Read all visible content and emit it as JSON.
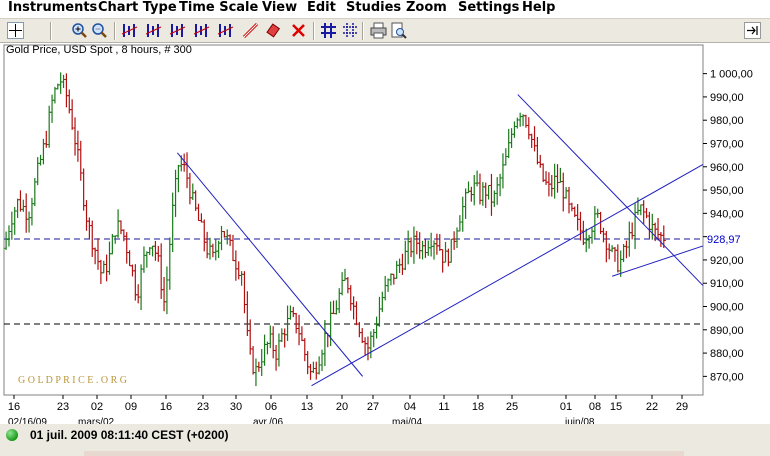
{
  "menu": [
    "Instruments",
    "Chart Type",
    "Time Scale",
    "View",
    "Edit",
    "Studies",
    "Zoom",
    "Settings",
    "Help"
  ],
  "toolbar": {
    "buttons": [
      "crosshair-icon",
      "zoom-in-icon",
      "zoom-out-icon",
      "candles-scale-1-icon",
      "candles-scale-2-icon",
      "candles-scale-3-icon",
      "candles-scale-4-icon",
      "candles-scale-5-icon",
      "draw-trendline-icon",
      "eraser-icon",
      "delete-drawings-icon",
      "grid-icon",
      "grid-dotted-icon",
      "print-icon",
      "print-preview-icon",
      "dock-icon"
    ]
  },
  "chart": {
    "title": "Gold Price, USD Spot , 8 hours, # 300",
    "watermark": "G O L D P R I C E . O R G",
    "last_price_label": "928,97",
    "y_ticks": [
      "1 000,00",
      "990,00",
      "980,00",
      "970,00",
      "960,00",
      "950,00",
      "940,00",
      "930,00",
      "920,00",
      "910,00",
      "900,00",
      "890,00",
      "880,00",
      "870,00"
    ],
    "x_ticks": [
      "16",
      "23",
      "02",
      "09",
      "16",
      "23",
      "30",
      "06",
      "13",
      "20",
      "27",
      "04",
      "11",
      "18",
      "25",
      "01",
      "08",
      "15",
      "22",
      "29"
    ],
    "x_month_labels": [
      "02/16/09",
      "mars/02",
      "avr./06",
      "mai/04",
      "juin/08"
    ],
    "colors": {
      "up": "#1a7a1a",
      "down": "#b01010",
      "trendline": "#2020c0",
      "hline": "#000080",
      "axis_text": "#000000",
      "last_label": "#0000cc"
    }
  },
  "chart_data": {
    "type": "ohlc",
    "ylim": [
      862,
      1008
    ],
    "dashed_levels": [
      928.97,
      892.5
    ],
    "last_price": 928.97,
    "trendlines": [
      {
        "from": [
          0.248,
          966
        ],
        "to": [
          0.513,
          870
        ]
      },
      {
        "from": [
          0.44,
          866
        ],
        "to": [
          1.0,
          961
        ]
      },
      {
        "from": [
          0.735,
          991
        ],
        "to": [
          1.0,
          909
        ]
      },
      {
        "from": [
          0.87,
          913
        ],
        "to": [
          1.0,
          926
        ]
      }
    ],
    "close_path": [
      [
        0,
        925
      ],
      [
        0.01,
        938
      ],
      [
        0.02,
        945
      ],
      [
        0.035,
        940
      ],
      [
        0.05,
        960
      ],
      [
        0.06,
        972
      ],
      [
        0.07,
        990
      ],
      [
        0.08,
        998
      ],
      [
        0.09,
        990
      ],
      [
        0.1,
        975
      ],
      [
        0.11,
        955
      ],
      [
        0.12,
        935
      ],
      [
        0.13,
        925
      ],
      [
        0.14,
        913
      ],
      [
        0.15,
        920
      ],
      [
        0.16,
        935
      ],
      [
        0.17,
        932
      ],
      [
        0.18,
        920
      ],
      [
        0.19,
        905
      ],
      [
        0.2,
        920
      ],
      [
        0.21,
        930
      ],
      [
        0.22,
        920
      ],
      [
        0.23,
        900
      ],
      [
        0.24,
        938
      ],
      [
        0.25,
        962
      ],
      [
        0.26,
        958
      ],
      [
        0.27,
        945
      ],
      [
        0.28,
        935
      ],
      [
        0.29,
        925
      ],
      [
        0.3,
        920
      ],
      [
        0.31,
        935
      ],
      [
        0.32,
        928
      ],
      [
        0.33,
        920
      ],
      [
        0.34,
        915
      ],
      [
        0.35,
        880
      ],
      [
        0.36,
        872
      ],
      [
        0.37,
        880
      ],
      [
        0.38,
        885
      ],
      [
        0.39,
        880
      ],
      [
        0.4,
        890
      ],
      [
        0.41,
        895
      ],
      [
        0.42,
        892
      ],
      [
        0.43,
        880
      ],
      [
        0.44,
        870
      ],
      [
        0.45,
        878
      ],
      [
        0.46,
        888
      ],
      [
        0.47,
        895
      ],
      [
        0.48,
        905
      ],
      [
        0.49,
        912
      ],
      [
        0.5,
        900
      ],
      [
        0.51,
        890
      ],
      [
        0.52,
        882
      ],
      [
        0.53,
        890
      ],
      [
        0.54,
        903
      ],
      [
        0.55,
        910
      ],
      [
        0.56,
        915
      ],
      [
        0.57,
        920
      ],
      [
        0.58,
        925
      ],
      [
        0.59,
        928
      ],
      [
        0.6,
        925
      ],
      [
        0.61,
        930
      ],
      [
        0.62,
        928
      ],
      [
        0.63,
        920
      ],
      [
        0.64,
        925
      ],
      [
        0.65,
        938
      ],
      [
        0.66,
        945
      ],
      [
        0.67,
        952
      ],
      [
        0.68,
        948
      ],
      [
        0.69,
        950
      ],
      [
        0.7,
        945
      ],
      [
        0.71,
        955
      ],
      [
        0.72,
        965
      ],
      [
        0.73,
        980
      ],
      [
        0.74,
        985
      ],
      [
        0.75,
        978
      ],
      [
        0.76,
        965
      ],
      [
        0.77,
        955
      ],
      [
        0.78,
        950
      ],
      [
        0.79,
        955
      ],
      [
        0.8,
        950
      ],
      [
        0.81,
        940
      ],
      [
        0.82,
        935
      ],
      [
        0.83,
        930
      ],
      [
        0.84,
        935
      ],
      [
        0.85,
        938
      ],
      [
        0.86,
        930
      ],
      [
        0.87,
        922
      ],
      [
        0.88,
        918
      ],
      [
        0.89,
        925
      ],
      [
        0.9,
        935
      ],
      [
        0.91,
        942
      ],
      [
        0.92,
        938
      ],
      [
        0.93,
        932
      ],
      [
        0.94,
        930
      ]
    ],
    "series_count": 300
  },
  "status": {
    "text": "01 juil. 2009 08:11:40  CEST (+0200)"
  }
}
